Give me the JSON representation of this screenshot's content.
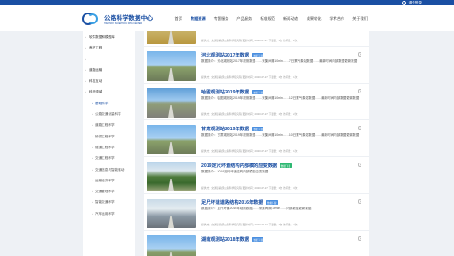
{
  "topbar": {
    "login_label": "请先登录",
    "avatar_icon": "user-icon"
  },
  "header": {
    "logo_cn": "公路科学数据中心",
    "logo_en": "HIGHWAY SCIENTIFIC DATA CENTER"
  },
  "nav": {
    "items": [
      "首页",
      "数据资源",
      "专题服务",
      "产品服务",
      "标准规范",
      "新闻动态",
      "成果转化",
      "学术合作",
      "关于我们"
    ],
    "active_index": 1
  },
  "sidebar": {
    "items": [
      {
        "label": "软件数据和模型库",
        "level": 0,
        "active": false
      },
      {
        "label": "养护工程",
        "level": 0,
        "active": false
      },
      {
        "label": "",
        "level": 0,
        "active": false
      },
      {
        "label": "道路运输",
        "level": 0,
        "active": false
      },
      {
        "label": "科技互动",
        "level": 0,
        "active": false
      },
      {
        "label": "科研领域",
        "level": 0,
        "active": false
      },
      {
        "label": "基础科学",
        "level": 1,
        "active": true
      },
      {
        "label": "公路交通计量科学",
        "level": 1,
        "active": false
      },
      {
        "label": "道路工程科学",
        "level": 1,
        "active": false
      },
      {
        "label": "桥梁工程科学",
        "level": 1,
        "active": false
      },
      {
        "label": "隧道工程科学",
        "level": 1,
        "active": false
      },
      {
        "label": "交通工程科学",
        "level": 1,
        "active": false
      },
      {
        "label": "交通信息与智能驱动",
        "level": 1,
        "active": false
      },
      {
        "label": "运输经济科学",
        "level": 1,
        "active": false
      },
      {
        "label": "交通管理科学",
        "level": 1,
        "active": false
      },
      {
        "label": "智能交通科学",
        "level": 1,
        "active": false
      },
      {
        "label": "汽车运用科学",
        "level": 1,
        "active": false
      }
    ]
  },
  "cards": [
    {
      "title": "",
      "badge": "",
      "desc": "",
      "meta": "提供方：交通运输部公路科学研究院    更新时间：2020-07-27    下载量：0次    访问量：2次",
      "thumb": "t-field"
    },
    {
      "title": "河北观测站2017年数据",
      "badge": "数据下载",
      "desc": "数据简介：河北观测站2017年观测数据……采集间隔10min……7日累气象站数据……最新时间内部数据更新数据",
      "meta": "提供方：交通运输部公路科学研究院    更新时间：2020-07-27    下载量：0次    访问量：1次",
      "thumb": "t-road"
    },
    {
      "title": "哈图观测站2019年数据",
      "badge": "数据下载",
      "desc": "数据简介：哈图观测站2019年观测数据……采集间隔10min……12日累气象站数据……最新时间内部数据更新数据",
      "meta": "提供方：交通运输部公路科学研究院    更新时间：2020-07-27    下载量：0次    访问量：2次",
      "thumb": "t-road2"
    },
    {
      "title": "甘肃观测站2019年数据",
      "badge": "数据下载",
      "desc": "数据简介：甘肃观测站2019年观测数据……采集间隔10min……10日累气象站数据……最新时间内部数据更新数据",
      "meta": "提供方：交通运输部公路科学研究院    更新时间：2020-07-27    下载量：0次    访问量：1次",
      "thumb": "t-road"
    },
    {
      "title": "2019定尺坏道结构内部模的应变数据",
      "badge": "数据下载",
      "badge_color": "green",
      "desc": "数据简介：2019定尺坏道结构内部模的应变数据",
      "meta": "提供方：交通运输部公路科学研究院    更新时间：2020-07-27    下载量：0次    访问量：3次",
      "thumb": "t-tree"
    },
    {
      "title": "足尺坏道道路结构2016年数据",
      "badge": "数据下载",
      "desc": "数据简介：足尺坏道2016年观测数据……采集间隔10min……内部数据更新数据",
      "meta": "提供方：交通运输部公路科学研究院    更新时间：2020-07-22    下载量：0次    访问量：2次",
      "thumb": "t-veh"
    },
    {
      "title": "湖南观测站2018年数据",
      "badge": "数据下载",
      "desc": "",
      "meta": "",
      "thumb": "t-road"
    }
  ]
}
